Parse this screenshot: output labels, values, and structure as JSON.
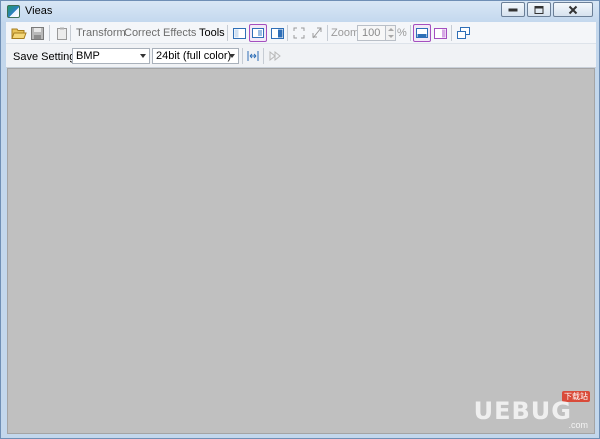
{
  "window": {
    "title": "Vieas"
  },
  "toolbar": {
    "menus": [
      "Transform",
      "Correct",
      "Effects",
      "Tools"
    ],
    "active_menu": "Tools",
    "zoom_label": "Zoom",
    "zoom_value": "100",
    "zoom_unit": "%"
  },
  "save_bar": {
    "label": "Save Settings",
    "format": "BMP",
    "bit_depth": "24bit (full color)"
  },
  "watermark": {
    "brand": "UEBUG",
    "tag": "下载站",
    "domain": ".com"
  },
  "icons": {
    "open": "folder-open-icon",
    "save": "save-icon",
    "clipboard": "clipboard-icon",
    "fit": "fit-window-icon",
    "actual": "actual-size-icon",
    "accent": "#a44fbf",
    "icon_blue": "#2f6fb7",
    "canvas": "#c0c0c0"
  }
}
